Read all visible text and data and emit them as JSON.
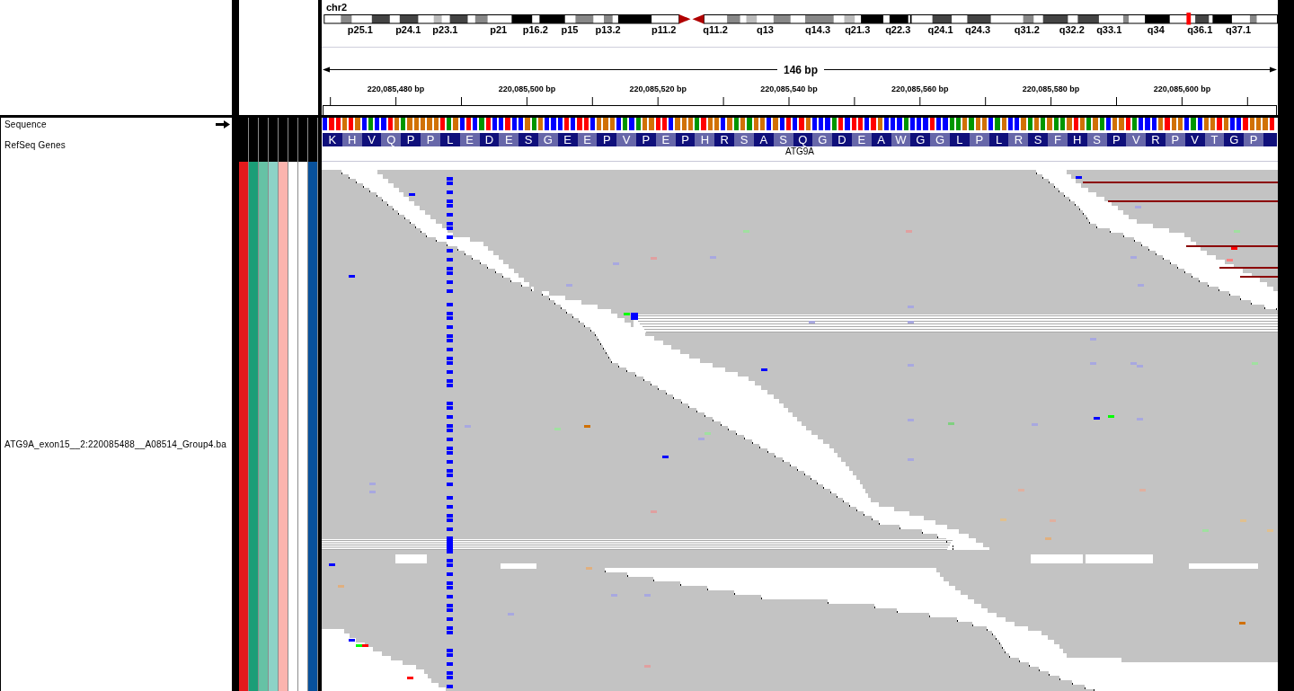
{
  "chromosome": {
    "name": "chr2",
    "bands": [
      "p25.1",
      "p24.1",
      "p23.1",
      "p21",
      "p16.2",
      "p15",
      "p13.2",
      "p11.2",
      "q11.2",
      "q13",
      "q14.3",
      "q21.3",
      "q22.3",
      "q24.1",
      "q24.3",
      "q31.2",
      "q32.2",
      "q33.1",
      "q34",
      "q36.1",
      "q37.1"
    ]
  },
  "ruler": {
    "span": "146 bp",
    "positions": [
      "220,085,480 bp",
      "220,085,500 bp",
      "220,085,520 bp",
      "220,085,540 bp",
      "220,085,560 bp",
      "220,085,580 bp",
      "220,085,600 bp"
    ]
  },
  "tracks": [
    {
      "kind": "sequence",
      "name": "Sequence",
      "forward_strand": true,
      "bases": [
        {
          "color": "#0000ff"
        },
        {
          "color": "#ff0000"
        },
        {
          "color": "#ff0000"
        },
        {
          "color": "#d17105"
        },
        {
          "color": "#ff0000"
        },
        {
          "color": "#d17105"
        },
        {
          "color": "#0000ff"
        },
        {
          "color": "#009600"
        },
        {
          "color": "#0000ff"
        },
        {
          "color": "#0000ff"
        },
        {
          "color": "#ff0000"
        },
        {
          "color": "#d17105"
        },
        {
          "color": "#009600"
        },
        {
          "color": "#d17105"
        },
        {
          "color": "#d17105"
        },
        {
          "color": "#d17105"
        },
        {
          "color": "#d17105"
        },
        {
          "color": "#d17105"
        },
        {
          "color": "#ff0000"
        },
        {
          "color": "#009600"
        },
        {
          "color": "#d17105"
        },
        {
          "color": "#0000ff"
        },
        {
          "color": "#ff0000"
        },
        {
          "color": "#0000ff"
        },
        {
          "color": "#009600"
        },
        {
          "color": "#ff0000"
        },
        {
          "color": "#0000ff"
        },
        {
          "color": "#0000ff"
        },
        {
          "color": "#ff0000"
        },
        {
          "color": "#0000ff"
        },
        {
          "color": "#0000ff"
        },
        {
          "color": "#d17105"
        },
        {
          "color": "#009600"
        },
        {
          "color": "#d17105"
        },
        {
          "color": "#0000ff"
        },
        {
          "color": "#0000ff"
        },
        {
          "color": "#0000ff"
        },
        {
          "color": "#ff0000"
        },
        {
          "color": "#0000ff"
        },
        {
          "color": "#ff0000"
        },
        {
          "color": "#ff0000"
        },
        {
          "color": "#0000ff"
        },
        {
          "color": "#d17105"
        },
        {
          "color": "#d17105"
        },
        {
          "color": "#d17105"
        },
        {
          "color": "#0000ff"
        },
        {
          "color": "#009600"
        },
        {
          "color": "#0000ff"
        },
        {
          "color": "#009600"
        },
        {
          "color": "#d17105"
        },
        {
          "color": "#d17105"
        },
        {
          "color": "#ff0000"
        },
        {
          "color": "#ff0000"
        },
        {
          "color": "#0000ff"
        },
        {
          "color": "#d17105"
        },
        {
          "color": "#d17105"
        },
        {
          "color": "#d17105"
        },
        {
          "color": "#009600"
        },
        {
          "color": "#ff0000"
        },
        {
          "color": "#d17105"
        },
        {
          "color": "#d17105"
        },
        {
          "color": "#0000ff"
        },
        {
          "color": "#d17105"
        },
        {
          "color": "#009600"
        },
        {
          "color": "#d17105"
        },
        {
          "color": "#009600"
        },
        {
          "color": "#d17105"
        },
        {
          "color": "#d17105"
        },
        {
          "color": "#0000ff"
        },
        {
          "color": "#d17105"
        },
        {
          "color": "#0000ff"
        },
        {
          "color": "#ff0000"
        },
        {
          "color": "#0000ff"
        },
        {
          "color": "#ff0000"
        },
        {
          "color": "#d17105"
        },
        {
          "color": "#0000ff"
        },
        {
          "color": "#0000ff"
        },
        {
          "color": "#0000ff"
        },
        {
          "color": "#009600"
        },
        {
          "color": "#ff0000"
        },
        {
          "color": "#0000ff"
        },
        {
          "color": "#ff0000"
        },
        {
          "color": "#ff0000"
        },
        {
          "color": "#0000ff"
        },
        {
          "color": "#ff0000"
        },
        {
          "color": "#d17105"
        },
        {
          "color": "#0000ff"
        },
        {
          "color": "#0000ff"
        },
        {
          "color": "#0000ff"
        },
        {
          "color": "#009600"
        },
        {
          "color": "#0000ff"
        },
        {
          "color": "#0000ff"
        },
        {
          "color": "#0000ff"
        },
        {
          "color": "#ff0000"
        },
        {
          "color": "#0000ff"
        },
        {
          "color": "#0000ff"
        },
        {
          "color": "#009600"
        },
        {
          "color": "#009600"
        },
        {
          "color": "#d17105"
        },
        {
          "color": "#009600"
        },
        {
          "color": "#d17105"
        },
        {
          "color": "#d17105"
        },
        {
          "color": "#0000ff"
        },
        {
          "color": "#009600"
        },
        {
          "color": "#d17105"
        },
        {
          "color": "#0000ff"
        },
        {
          "color": "#0000ff"
        },
        {
          "color": "#d17105"
        },
        {
          "color": "#009600"
        },
        {
          "color": "#d17105"
        },
        {
          "color": "#009600"
        },
        {
          "color": "#d17105"
        },
        {
          "color": "#009600"
        },
        {
          "color": "#009600"
        },
        {
          "color": "#d17105"
        },
        {
          "color": "#ff0000"
        },
        {
          "color": "#d17105"
        },
        {
          "color": "#009600"
        },
        {
          "color": "#d17105"
        },
        {
          "color": "#009600"
        },
        {
          "color": "#0000ff"
        },
        {
          "color": "#d17105"
        },
        {
          "color": "#d17105"
        },
        {
          "color": "#ff0000"
        },
        {
          "color": "#009600"
        },
        {
          "color": "#0000ff"
        },
        {
          "color": "#0000ff"
        },
        {
          "color": "#0000ff"
        },
        {
          "color": "#d17105"
        },
        {
          "color": "#ff0000"
        },
        {
          "color": "#d17105"
        },
        {
          "color": "#d17105"
        },
        {
          "color": "#0000ff"
        },
        {
          "color": "#009600"
        },
        {
          "color": "#0000ff"
        },
        {
          "color": "#d17105"
        },
        {
          "color": "#d17105"
        },
        {
          "color": "#ff0000"
        },
        {
          "color": "#d17105"
        },
        {
          "color": "#0000ff"
        },
        {
          "color": "#0000ff"
        },
        {
          "color": "#ff0000"
        },
        {
          "color": "#d17105"
        },
        {
          "color": "#d17105"
        },
        {
          "color": "#d17105"
        },
        {
          "color": "#ff0000"
        }
      ]
    },
    {
      "kind": "gene",
      "name": "RefSeq Genes",
      "amino_acids": [
        "K",
        "H",
        "V",
        "Q",
        "P",
        "P",
        "L",
        "E",
        "D",
        "E",
        "S",
        "G",
        "E",
        "E",
        "P",
        "V",
        "P",
        "E",
        "P",
        "H",
        "R",
        "S",
        "A",
        "S",
        "Q",
        "G",
        "D",
        "E",
        "A",
        "W",
        "G",
        "G",
        "L",
        "P",
        "L",
        "R",
        "S",
        "F",
        "H",
        "S",
        "P",
        "V",
        "R",
        "P",
        "V",
        "T",
        "G",
        "P"
      ],
      "gene": "ATG9A"
    },
    {
      "kind": "alignment",
      "name": "ATG9A_exon15__2:220085488__A08514_Group4.ba",
      "attributes": [
        {
          "color": "#e41a1c"
        },
        {
          "color": "#1b9e77"
        },
        {
          "color": "#66c2a5"
        },
        {
          "color": "#8dd3c7"
        },
        {
          "color": "#fbb4ae"
        },
        {
          "color": "#ffffff"
        },
        {
          "color": "#ffffff"
        },
        {
          "color": "#08519c"
        }
      ]
    }
  ]
}
